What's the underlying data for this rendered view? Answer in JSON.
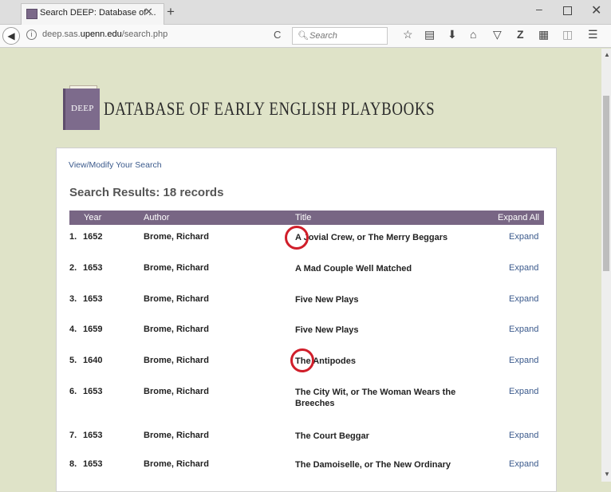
{
  "browser": {
    "tab_title": "Search DEEP: Database of ...",
    "url_prefix": "deep.sas.",
    "url_domain": "upenn.edu",
    "url_path": "/search.php",
    "search_placeholder": "Search"
  },
  "site": {
    "logo_text": "DEEP",
    "title": "DATABASE OF EARLY ENGLISH PLAYBOOKS"
  },
  "results": {
    "modify_link": "View/Modify Your Search",
    "heading": "Search Results: 18 records",
    "columns": {
      "year": "Year",
      "author": "Author",
      "title": "Title",
      "expand_all": "Expand All"
    },
    "rows": [
      {
        "num": "1.",
        "year": "1652",
        "author": "Brome, Richard",
        "title": "A Jovial Crew, or The Merry Beggars",
        "expand": "Expand"
      },
      {
        "num": "2.",
        "year": "1653",
        "author": "Brome, Richard",
        "title": "A Mad Couple Well Matched",
        "expand": "Expand"
      },
      {
        "num": "3.",
        "year": "1653",
        "author": "Brome, Richard",
        "title": "Five New Plays",
        "expand": "Expand"
      },
      {
        "num": "4.",
        "year": "1659",
        "author": "Brome, Richard",
        "title": "Five New Plays",
        "expand": "Expand"
      },
      {
        "num": "5.",
        "year": "1640",
        "author": "Brome, Richard",
        "title": "The Antipodes",
        "expand": "Expand"
      },
      {
        "num": "6.",
        "year": "1653",
        "author": "Brome, Richard",
        "title": "The City Wit, or The Woman Wears the Breeches",
        "expand": "Expand"
      },
      {
        "num": "7.",
        "year": "1653",
        "author": "Brome, Richard",
        "title": "The Court Beggar",
        "expand": "Expand"
      },
      {
        "num": "8.",
        "year": "1653",
        "author": "Brome, Richard",
        "title": "The Damoiselle, or The New Ordinary",
        "expand": "Expand"
      }
    ]
  },
  "colors": {
    "header_purple": "#786684",
    "link_blue": "#3b5a8c",
    "highlight_red": "#d01e2a",
    "page_bg": "#dfe3c8"
  }
}
